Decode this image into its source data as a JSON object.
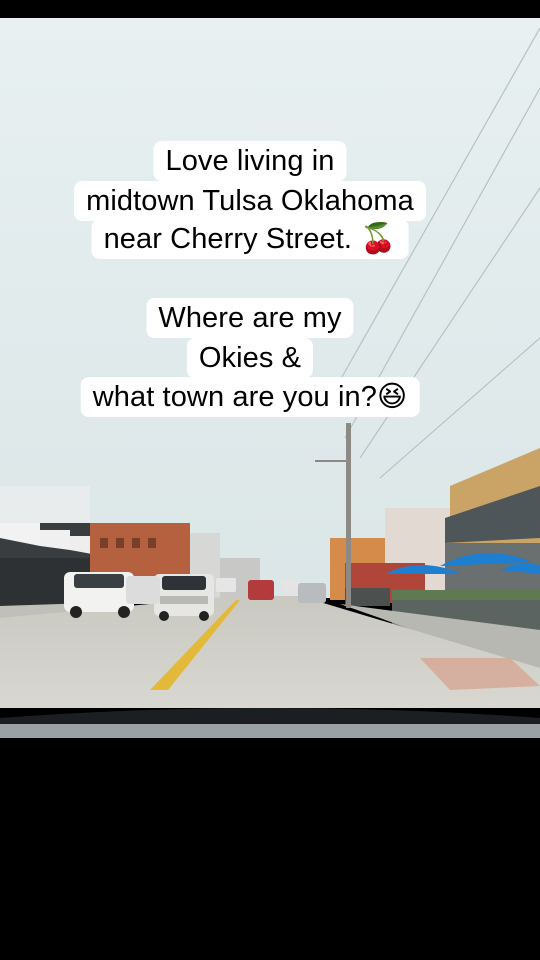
{
  "caption": {
    "lines": [
      "Love living in",
      "midtown Tulsa Oklahoma",
      "near Cherry Street. 🍒",
      "Where are my",
      "Okies &",
      "what town are you in?😆"
    ],
    "icons": [
      "cherries-emoji",
      "laughing-face-emoji"
    ]
  },
  "scene": {
    "description_icons": [
      "road",
      "cars",
      "storefronts",
      "umbrellas",
      "utility-pole"
    ],
    "colors": {
      "sky": "#dfe9ea",
      "road": "#cfcfc8",
      "center_line": "#e3b93a",
      "dashboard": "#1c1f22",
      "umbrella": "#1e7fd0",
      "brick": "#b5603f"
    }
  }
}
